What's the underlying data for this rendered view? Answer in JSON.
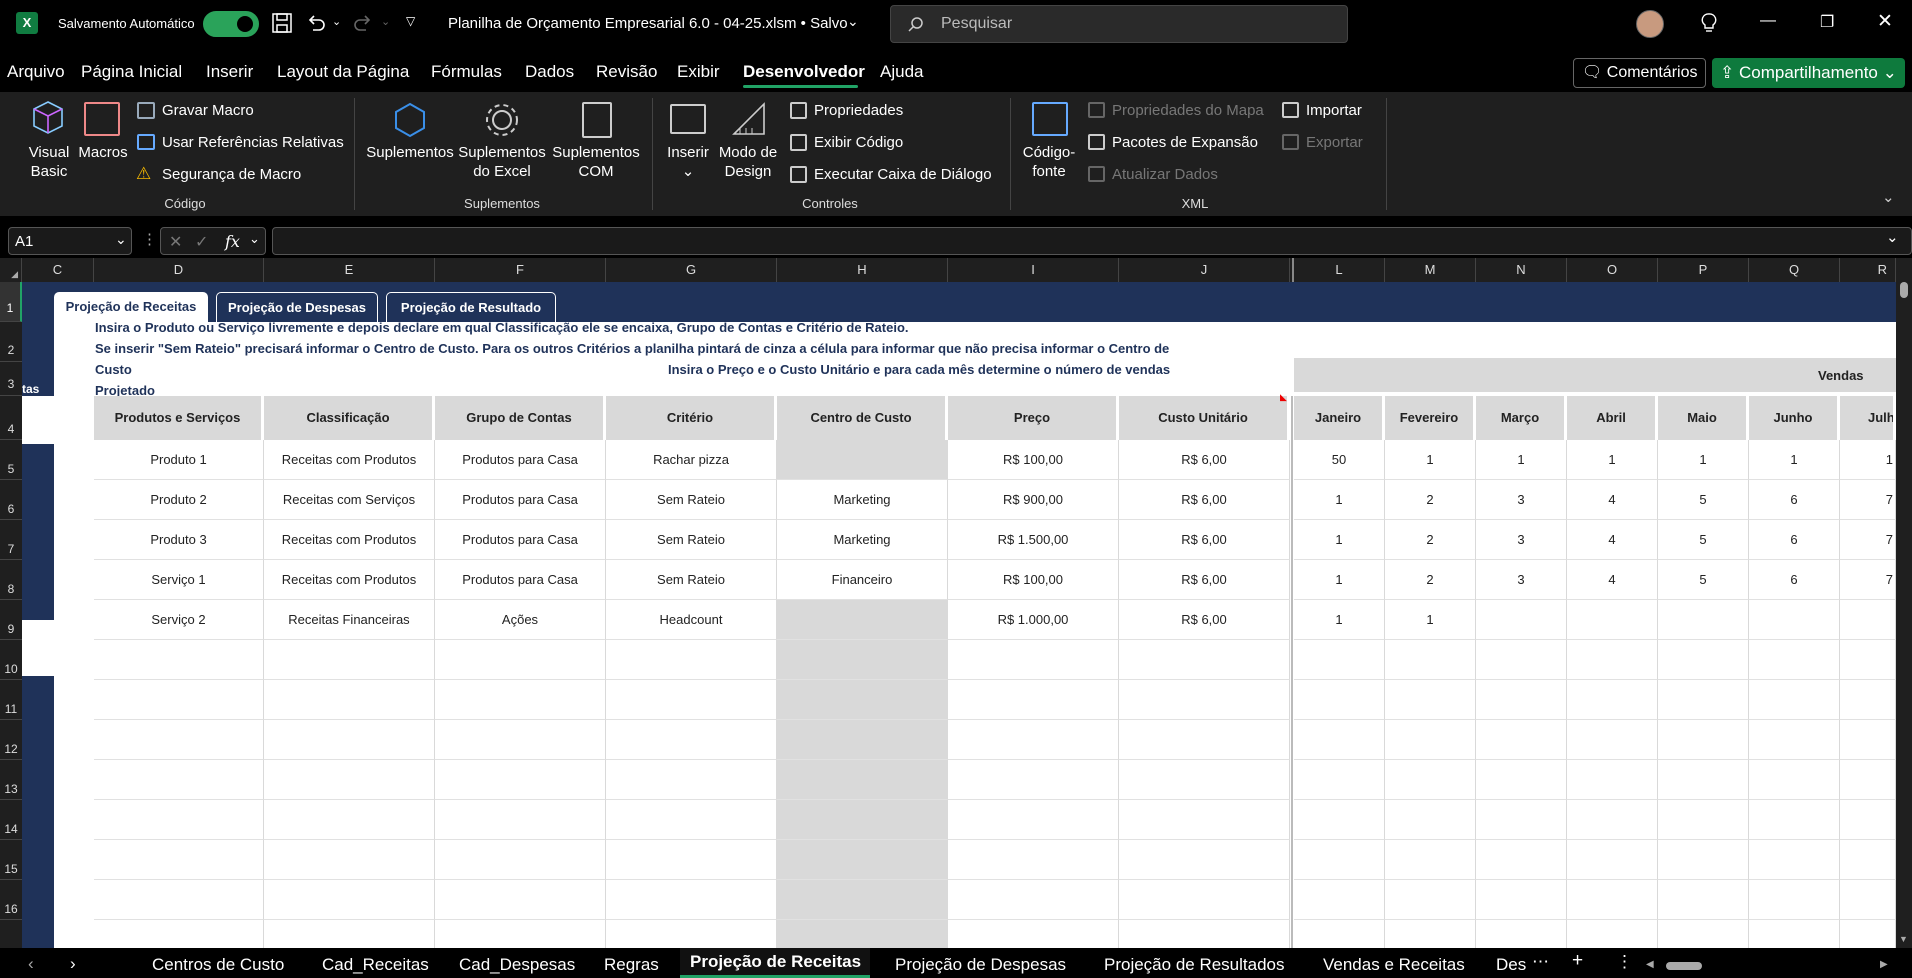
{
  "titlebar": {
    "autosave_label": "Salvamento Automático",
    "file_title": "Planilha de Orçamento Empresarial 6.0 - 04-25.xlsm • Salvo",
    "search_placeholder": "Pesquisar"
  },
  "menu": {
    "items": [
      "Arquivo",
      "Página Inicial",
      "Inserir",
      "Layout da Página",
      "Fórmulas",
      "Dados",
      "Revisão",
      "Exibir",
      "Desenvolvedor",
      "Ajuda"
    ],
    "active": "Desenvolvedor",
    "comments_label": "Comentários",
    "share_label": "Compartilhamento"
  },
  "ribbon": {
    "codigo": {
      "group_label": "Código",
      "visual_basic": "Visual Basic",
      "macros": "Macros",
      "gravar_macro": "Gravar Macro",
      "usar_refs": "Usar Referências Relativas",
      "seguranca": "Segurança de Macro"
    },
    "suplementos": {
      "group_label": "Suplementos",
      "suplementos": "Suplementos",
      "excel": "Suplementos do Excel",
      "com": "Suplementos COM"
    },
    "controles": {
      "group_label": "Controles",
      "inserir": "Inserir",
      "modo_design": "Modo de Design",
      "propriedades": "Propriedades",
      "exibir_codigo": "Exibir Código",
      "executar_caixa": "Executar Caixa de Diálogo"
    },
    "xml": {
      "group_label": "XML",
      "codigo_fonte": "Código-fonte",
      "propriedades_mapa": "Propriedades do Mapa",
      "pacotes": "Pacotes de Expansão",
      "atualizar": "Atualizar Dados",
      "importar": "Importar",
      "exportar": "Exportar"
    }
  },
  "formula_bar": {
    "name_box": "A1",
    "fx": "fx",
    "value": ""
  },
  "grid": {
    "columns": [
      "C",
      "D",
      "E",
      "F",
      "G",
      "H",
      "I",
      "J",
      "L",
      "M",
      "N",
      "O",
      "P",
      "Q",
      "R"
    ],
    "rows": [
      "1",
      "2",
      "3",
      "4",
      "5",
      "6",
      "7",
      "8",
      "9",
      "10",
      "11",
      "12",
      "13",
      "14",
      "15",
      "16"
    ],
    "page_tabs": [
      "Projeção de Receitas",
      "Projeção de Despesas",
      "Projeção de Resultado"
    ],
    "instructions": {
      "line1": "Insira o Produto ou Serviço livremente e depois declare em qual Classificação ele se encaixa, Grupo de Contas e Critério de Rateio.",
      "line2": "Se inserir \"Sem Rateio\" precisará informar o Centro de Custo.  Para os outros Critérios a planilha pintará de cinza a célula para informar que não precisa informar o Centro de",
      "line3": "Custo",
      "line3b": "Insira o Preço e o Custo Unitário e para cada mês determine o número de vendas",
      "line4": "Projetado"
    },
    "side_label": "tas",
    "vendas_label": "Vendas",
    "headers": [
      "Produtos e Serviços",
      "Classificação",
      "Grupo de Contas",
      "Critério",
      "Centro de Custo",
      "Preço",
      "Custo Unitário"
    ],
    "months": [
      "Janeiro",
      "Fevereiro",
      "Março",
      "Abril",
      "Maio",
      "Junho",
      "Julh"
    ],
    "rows_data": [
      {
        "produto": "Produto 1",
        "classificacao": "Receitas com Produtos",
        "grupo": "Produtos para Casa",
        "criterio": "Rachar pizza",
        "centro": "",
        "preco": "R$ 100,00",
        "custo": "R$ 6,00",
        "vendas": [
          "50",
          "1",
          "1",
          "1",
          "1",
          "1",
          "1"
        ],
        "grey": true
      },
      {
        "produto": "Produto 2",
        "classificacao": "Receitas com Serviços",
        "grupo": "Produtos para Casa",
        "criterio": "Sem Rateio",
        "centro": "Marketing",
        "preco": "R$ 900,00",
        "custo": "R$ 6,00",
        "vendas": [
          "1",
          "2",
          "3",
          "4",
          "5",
          "6",
          "7"
        ],
        "grey": false
      },
      {
        "produto": "Produto 3",
        "classificacao": "Receitas com Produtos",
        "grupo": "Produtos para Casa",
        "criterio": "Sem Rateio",
        "centro": "Marketing",
        "preco": "R$ 1.500,00",
        "custo": "R$ 6,00",
        "vendas": [
          "1",
          "2",
          "3",
          "4",
          "5",
          "6",
          "7"
        ],
        "grey": false
      },
      {
        "produto": "Serviço 1",
        "classificacao": "Receitas com Produtos",
        "grupo": "Produtos para Casa",
        "criterio": "Sem Rateio",
        "centro": "Financeiro",
        "preco": "R$ 100,00",
        "custo": "R$ 6,00",
        "vendas": [
          "1",
          "2",
          "3",
          "4",
          "5",
          "6",
          "7"
        ],
        "grey": false
      },
      {
        "produto": "Serviço 2",
        "classificacao": "Receitas Financeiras",
        "grupo": "Ações",
        "criterio": "Headcount",
        "centro": "",
        "preco": "R$ 1.000,00",
        "custo": "R$ 6,00",
        "vendas": [
          "1",
          "1",
          "",
          "",
          "",
          "",
          ""
        ],
        "grey": true
      }
    ]
  },
  "sheet_tabs": {
    "items": [
      "Centros de Custo",
      "Cad_Receitas",
      "Cad_Despesas",
      "Regras",
      "Projeção de Receitas",
      "Projeção de Despesas",
      "Projeção de Resultados",
      "Vendas e Receitas",
      "Des"
    ],
    "active": "Projeção de Receitas"
  }
}
